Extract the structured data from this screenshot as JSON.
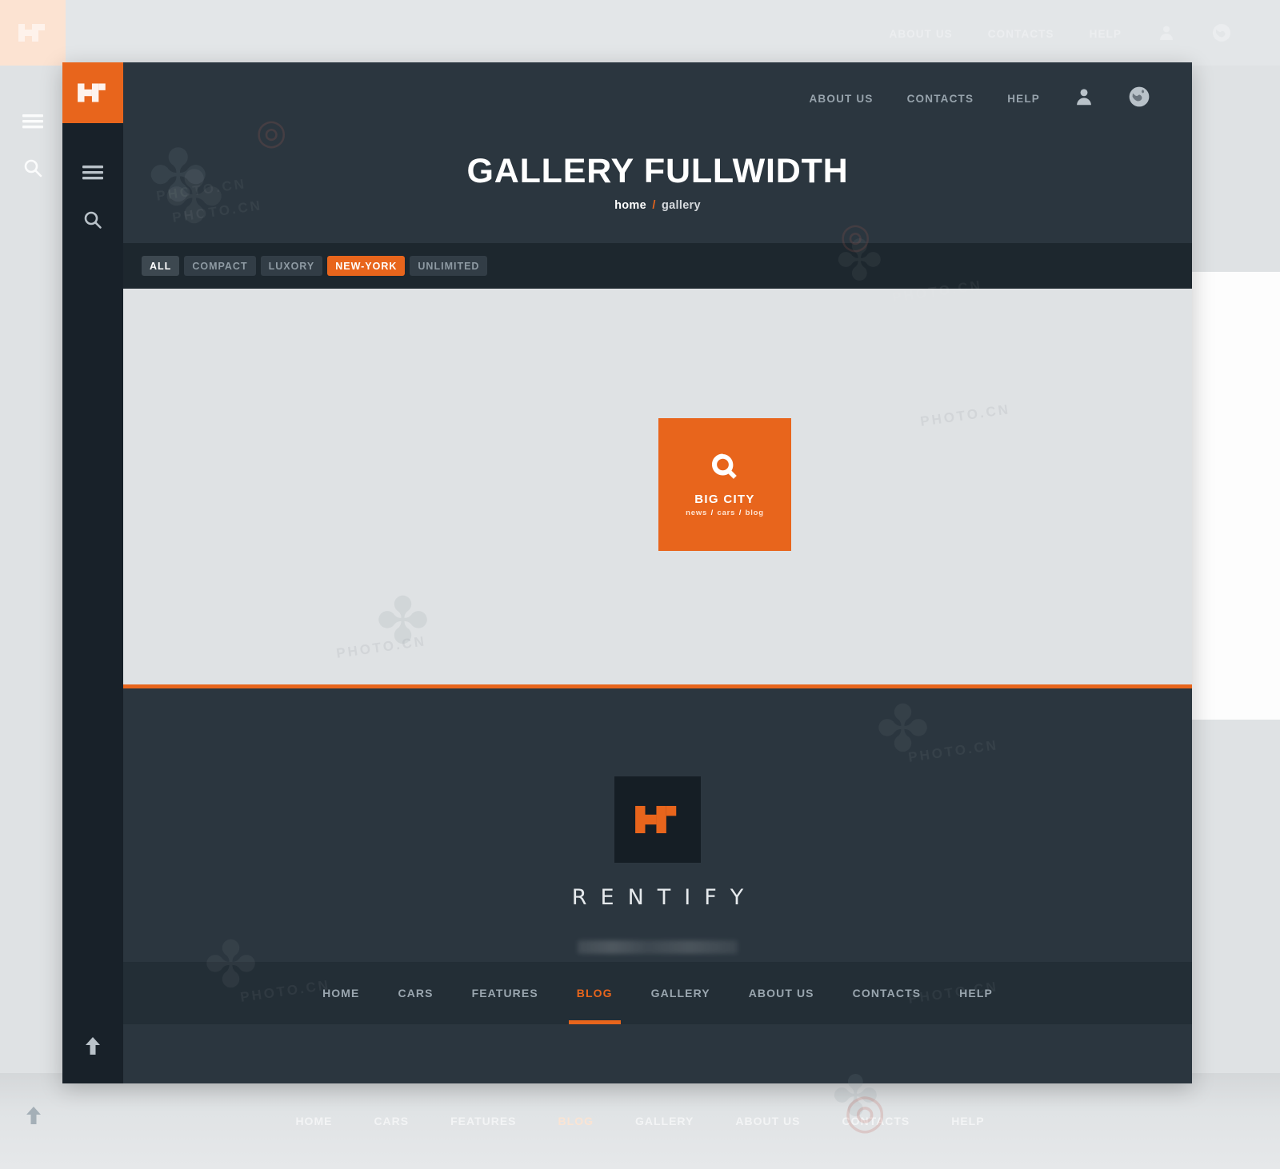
{
  "brand": {
    "logo_icon": "rentify-logo-icon",
    "footer_name": "RENTIFY"
  },
  "rail": {
    "menu_icon": "hamburger-menu-icon",
    "search_icon": "search-icon",
    "scroll_top_icon": "arrow-up-icon"
  },
  "header": {
    "nav": [
      {
        "label": "ABOUT US"
      },
      {
        "label": "CONTACTS"
      },
      {
        "label": "HELP"
      }
    ],
    "account_icon": "user-icon",
    "language_icon": "globe-icon",
    "title": "GALLERY FULLWIDTH",
    "breadcrumb": {
      "home": "home",
      "separator": "/",
      "current": "gallery"
    }
  },
  "filters": [
    {
      "label": "ALL",
      "state": "active"
    },
    {
      "label": "COMPACT",
      "state": "default"
    },
    {
      "label": "LUXORY",
      "state": "default"
    },
    {
      "label": "NEW-YORK",
      "state": "accent"
    },
    {
      "label": "UNLIMITED",
      "state": "default"
    }
  ],
  "gallery": {
    "card": {
      "icon": "magnifier-q-icon",
      "title": "BIG CITY",
      "tags": [
        "news",
        "cars",
        "blog"
      ],
      "separator": "/"
    }
  },
  "bottom_nav": [
    {
      "label": "HOME",
      "active": false
    },
    {
      "label": "CARS",
      "active": false
    },
    {
      "label": "FEATURES",
      "active": false
    },
    {
      "label": "BLOG",
      "active": true
    },
    {
      "label": "GALLERY",
      "active": false
    },
    {
      "label": "ABOUT US",
      "active": false
    },
    {
      "label": "CONTACTS",
      "active": false
    },
    {
      "label": "HELP",
      "active": false
    }
  ],
  "colors": {
    "accent": "#e8651c",
    "dark": "#2b363f",
    "darker": "#1d272e",
    "rail": "#182129",
    "light": "#dfe2e4"
  },
  "watermark": {
    "text": "PHOTO.CN"
  }
}
